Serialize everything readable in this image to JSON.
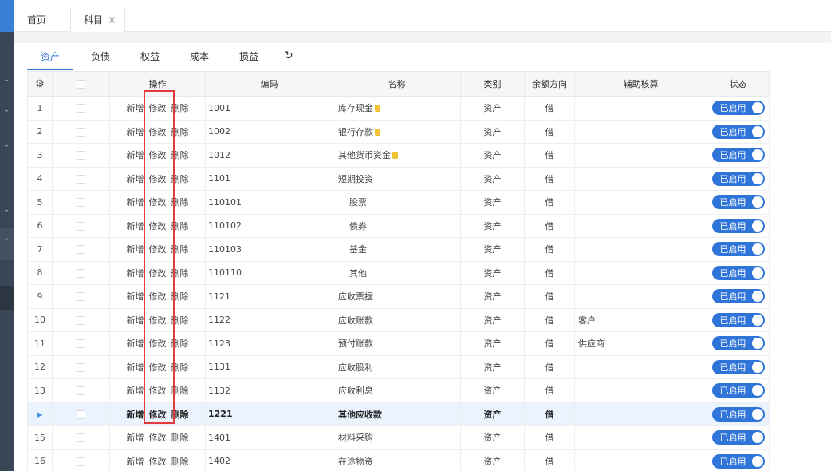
{
  "tabs": {
    "home": "首页",
    "current": "科目",
    "close": "×"
  },
  "categories": [
    "资产",
    "负债",
    "权益",
    "成本",
    "损益"
  ],
  "refresh_icon": "refresh-icon",
  "columns": {
    "settings": "settings-icon",
    "ops": "操作",
    "code": "编码",
    "name": "名称",
    "type": "类别",
    "direction": "余额方向",
    "aux": "辅助核算",
    "status": "状态"
  },
  "ops": {
    "add": "新增",
    "edit": "修改",
    "del": "删除"
  },
  "status_label": "已启用",
  "accent_color": "#2f74d9",
  "highlight_color": "#e23b3b",
  "rows": [
    {
      "no": "1",
      "code": "1001",
      "name": "库存现金",
      "coin": true,
      "type": "资产",
      "dir": "借",
      "aux": ""
    },
    {
      "no": "2",
      "code": "1002",
      "name": "银行存款",
      "coin": true,
      "type": "资产",
      "dir": "借",
      "aux": ""
    },
    {
      "no": "3",
      "code": "1012",
      "name": "其他货币资金",
      "coin": true,
      "type": "资产",
      "dir": "借",
      "aux": ""
    },
    {
      "no": "4",
      "code": "1101",
      "name": "短期投资",
      "coin": false,
      "type": "资产",
      "dir": "借",
      "aux": ""
    },
    {
      "no": "5",
      "code": "110101",
      "name": "股票",
      "coin": false,
      "sub": true,
      "type": "资产",
      "dir": "借",
      "aux": ""
    },
    {
      "no": "6",
      "code": "110102",
      "name": "债券",
      "coin": false,
      "sub": true,
      "type": "资产",
      "dir": "借",
      "aux": ""
    },
    {
      "no": "7",
      "code": "110103",
      "name": "基金",
      "coin": false,
      "sub": true,
      "type": "资产",
      "dir": "借",
      "aux": ""
    },
    {
      "no": "8",
      "code": "110110",
      "name": "其他",
      "coin": false,
      "sub": true,
      "type": "资产",
      "dir": "借",
      "aux": ""
    },
    {
      "no": "9",
      "code": "1121",
      "name": "应收票据",
      "coin": false,
      "type": "资产",
      "dir": "借",
      "aux": ""
    },
    {
      "no": "10",
      "code": "1122",
      "name": "应收账款",
      "coin": false,
      "type": "资产",
      "dir": "借",
      "aux": "客户"
    },
    {
      "no": "11",
      "code": "1123",
      "name": "预付账款",
      "coin": false,
      "type": "资产",
      "dir": "借",
      "aux": "供应商"
    },
    {
      "no": "12",
      "code": "1131",
      "name": "应收股利",
      "coin": false,
      "type": "资产",
      "dir": "借",
      "aux": ""
    },
    {
      "no": "13",
      "code": "1132",
      "name": "应收利息",
      "coin": false,
      "type": "资产",
      "dir": "借",
      "aux": ""
    },
    {
      "no": "",
      "code": "1221",
      "name": "其他应收款",
      "coin": false,
      "type": "资产",
      "dir": "借",
      "aux": "",
      "selected": true
    },
    {
      "no": "15",
      "code": "1401",
      "name": "材料采购",
      "coin": false,
      "type": "资产",
      "dir": "借",
      "aux": ""
    },
    {
      "no": "16",
      "code": "1402",
      "name": "在途物资",
      "coin": false,
      "type": "资产",
      "dir": "借",
      "aux": ""
    }
  ]
}
